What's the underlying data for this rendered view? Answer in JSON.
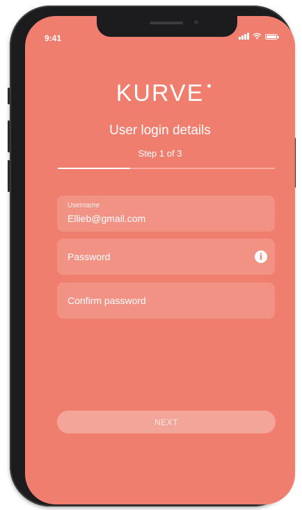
{
  "status_bar": {
    "time": "9:41",
    "icons": [
      "signal-icon",
      "wifi-icon",
      "battery-icon"
    ]
  },
  "brand": {
    "logo_text": "KURVE",
    "color": "#f07e6e"
  },
  "header": {
    "title": "User login details",
    "step_text": "Step 1 of 3",
    "progress": 0.333
  },
  "form": {
    "username": {
      "label": "Username",
      "value": "Ellieb@gmail.com"
    },
    "password": {
      "placeholder": "Password",
      "icon": "info-icon"
    },
    "confirm_password": {
      "placeholder": "Confirm password"
    }
  },
  "actions": {
    "next_label": "NEXT"
  }
}
